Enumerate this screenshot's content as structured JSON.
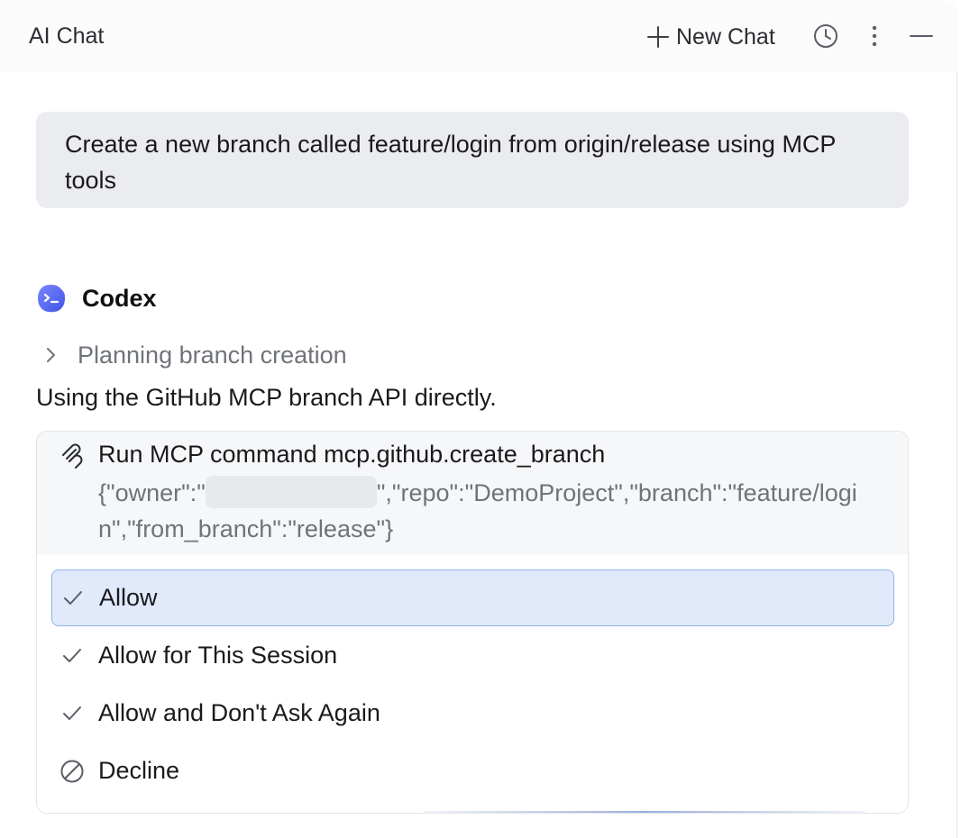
{
  "header": {
    "title": "AI Chat",
    "new_chat_label": "New Chat",
    "icons": [
      "plus-icon",
      "history-icon",
      "more-vertical-icon",
      "minimize-icon"
    ]
  },
  "user_message": {
    "text": "Create a new branch called feature/login from origin/release using MCP tools"
  },
  "agent": {
    "name": "Codex",
    "thinking_label": "Planning branch creation",
    "reply": "Using the GitHub MCP branch API directly."
  },
  "tool_call": {
    "command": "Run MCP command mcp.github.create_branch",
    "args_before": "{\"owner\":\"",
    "args_after": "\",\"repo\":\"DemoProject\",\"branch\":\"feature/login\",\"from_branch\":\"release\"}"
  },
  "permission_options": [
    {
      "label": "Allow",
      "icon": "check-icon",
      "selected": true
    },
    {
      "label": "Allow for This Session",
      "icon": "check-icon",
      "selected": false
    },
    {
      "label": "Allow and Don't Ask Again",
      "icon": "check-icon",
      "selected": false
    },
    {
      "label": "Decline",
      "icon": "prohibited-icon",
      "selected": false
    }
  ],
  "colors": {
    "accent_selected_bg": "#e1eafb",
    "accent_selected_border": "#8fb2ee",
    "user_bubble": "#ebecf0",
    "muted_text": "#6f737a",
    "agent_logo": "#5b6cf0"
  }
}
